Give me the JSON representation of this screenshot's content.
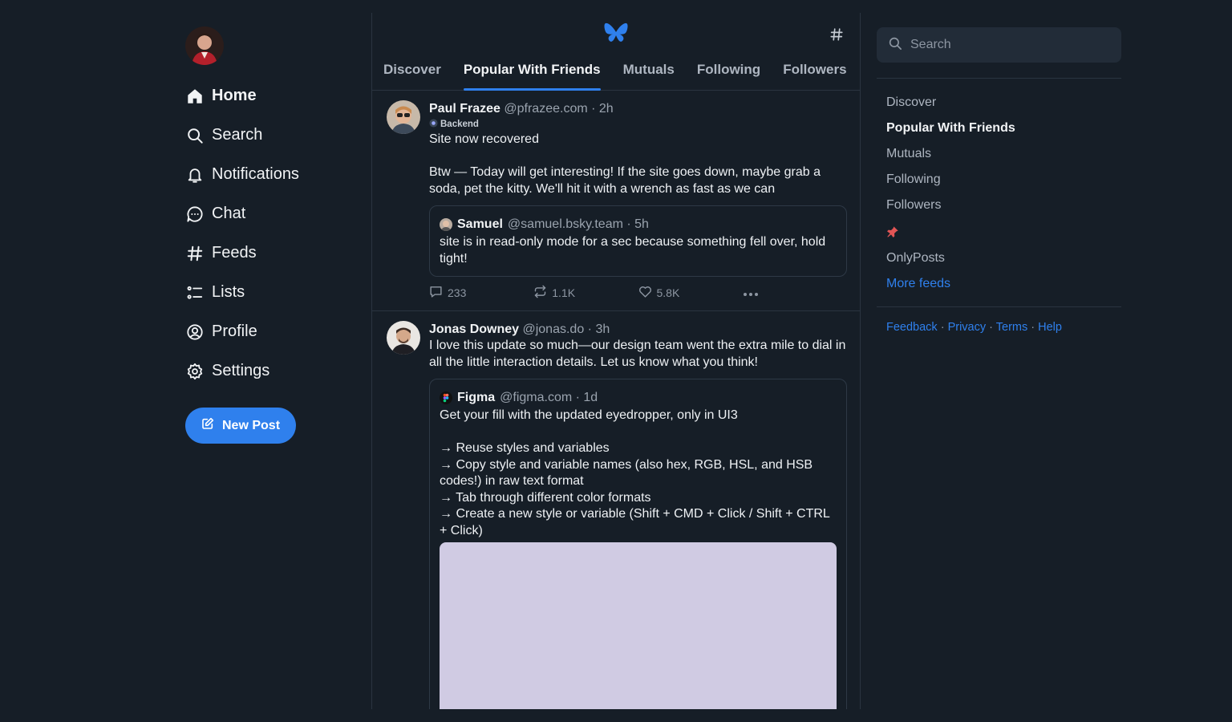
{
  "nav": {
    "items": [
      {
        "label": "Home",
        "icon": "home-icon"
      },
      {
        "label": "Search",
        "icon": "search-icon"
      },
      {
        "label": "Notifications",
        "icon": "bell-icon"
      },
      {
        "label": "Chat",
        "icon": "chat-icon"
      },
      {
        "label": "Feeds",
        "icon": "hash-icon"
      },
      {
        "label": "Lists",
        "icon": "list-icon"
      },
      {
        "label": "Profile",
        "icon": "user-circle-icon"
      },
      {
        "label": "Settings",
        "icon": "gear-icon"
      }
    ],
    "new_post": "New Post"
  },
  "tabs": [
    "Discover",
    "Popular With Friends",
    "Mutuals",
    "Following",
    "Followers"
  ],
  "posts": [
    {
      "name": "Paul Frazee",
      "meta": "@pfrazee.com · 2h",
      "label": "Backend",
      "text": "Site now recovered\n\nBtw — Today will get interesting! If the site goes down, maybe grab a soda, pet the kitty. We'll hit it with a wrench as fast as we can",
      "quote": {
        "name": "Samuel",
        "meta": "@samuel.bsky.team · 5h",
        "text": "site is in read-only mode for a sec because something fell over, hold tight!"
      },
      "replies": "233",
      "reposts": "1.1K",
      "likes": "5.8K"
    },
    {
      "name": "Jonas Downey",
      "meta": "@jonas.do · 3h",
      "text": "I love this update so much—our design team went the extra mile to dial in all the little interaction details. Let us know what you think!",
      "quote": {
        "name": "Figma",
        "meta": "@figma.com · 1d",
        "text": "Get your fill with the updated eyedropper, only in UI3\n\n→ Reuse styles and variables\n→ Copy style and variable names (also hex, RGB, HSL, and HSB codes!) in raw text format\n→ Tab through different color formats\n→ Create a new style or variable (Shift + CMD + Click / Shift + CTRL + Click)"
      }
    }
  ],
  "search": {
    "placeholder": "Search"
  },
  "right_feeds": [
    "Discover",
    "Popular With Friends",
    "Mutuals",
    "Following",
    "Followers"
  ],
  "right_feeds_extra": "OnlyPosts",
  "more_feeds": "More feeds",
  "footer": {
    "feedback": "Feedback",
    "privacy": "Privacy",
    "terms": "Terms",
    "help": "Help",
    "sep": " · "
  },
  "colors": {
    "background": "#161e27",
    "accent": "#2f80ed",
    "pin": "#e25555",
    "media_placeholder": "#d0cbe3"
  }
}
